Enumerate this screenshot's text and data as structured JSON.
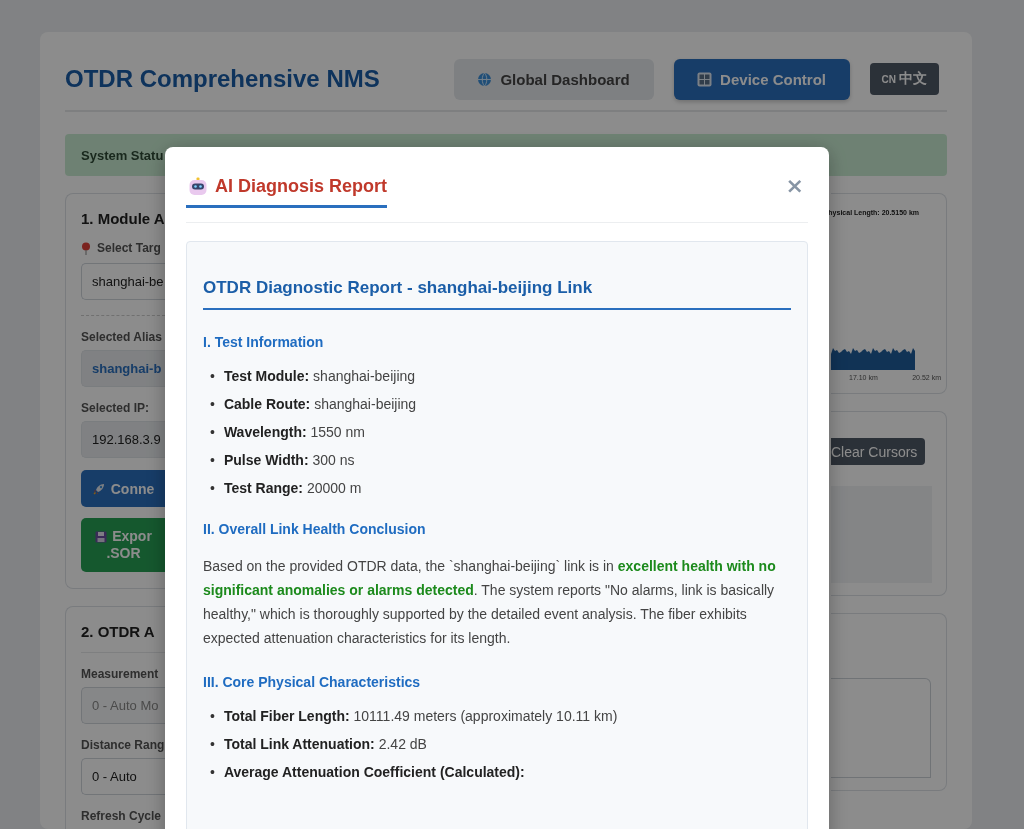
{
  "app": {
    "title": "OTDR Comprehensive NMS",
    "nav_buttons": [
      {
        "label": "Global Dashboard",
        "selected": false
      },
      {
        "label": "Device Control",
        "selected": true
      }
    ],
    "language_button": {
      "flag": "CN",
      "label": "中文"
    },
    "status_bar": {
      "text": "System Statu"
    },
    "module_panel": {
      "title": "1. Module A",
      "target_label": "Select Targ",
      "target_value": "shanghai-be",
      "alias_label": "Selected Alias",
      "alias_value": "shanghai-b",
      "ip_label": "Selected IP:",
      "ip_value": "192.168.3.9",
      "connect_button": "Conne",
      "export_button": [
        "Expor",
        ".SOR"
      ]
    },
    "otdr_panel": {
      "title": "2. OTDR A",
      "fields": [
        {
          "label": "Measurement",
          "value": "0 - Auto Mo",
          "disabled": true
        },
        {
          "label": "Distance Rang",
          "value": "0 - Auto",
          "disabled": false
        }
      ],
      "next_label": "Refresh Cycle"
    },
    "trace_panel": {
      "caption": "hysical Length: 20.5150 km",
      "x_labels": [
        "17.10 km",
        "20.52 km"
      ]
    },
    "cursor_panel": {
      "button": "Clear Cursors"
    }
  },
  "dialog": {
    "title": "AI Diagnosis Report",
    "close": "×",
    "report": {
      "heading": "OTDR Diagnostic Report - shanghai-beijing Link",
      "sections": [
        {
          "title": "I. Test Information",
          "kind": "list",
          "items": [
            {
              "marker": "•",
              "label": "Test Module:",
              "value": "shanghai-beijing"
            },
            {
              "marker": "•",
              "label": "Cable Route:",
              "value": "shanghai-beijing"
            },
            {
              "marker": "•",
              "label": "Wavelength:",
              "value": "1550 nm"
            },
            {
              "marker": "•",
              "label": "Pulse Width:",
              "value": "300 ns"
            },
            {
              "marker": "•",
              "label": "Test Range:",
              "value": "20000 m"
            }
          ]
        },
        {
          "title": "II. Overall Link Health Conclusion",
          "kind": "paragraph",
          "text": "Based on the provided OTDR data, the `shanghai-beijing` link is in **excellent health with no significant anomalies or alarms detected**. The system reports \"No alarms, link is basically healthy,\" which is thoroughly supported by the detailed event analysis. The fiber exhibits expected attenuation characteristics for its length."
        },
        {
          "title": "III. Core Physical Characteristics",
          "kind": "list",
          "items": [
            {
              "marker": "•",
              "label": "Total Fiber Length:",
              "value": "10111.49 meters (approximately 10.11 km)"
            },
            {
              "marker": "•",
              "label": "Total Link Attenuation:",
              "value": "2.42 dB"
            },
            {
              "marker": "•",
              "label": "Average Attenuation Coefficient (Calculated):"
            }
          ]
        }
      ]
    }
  }
}
